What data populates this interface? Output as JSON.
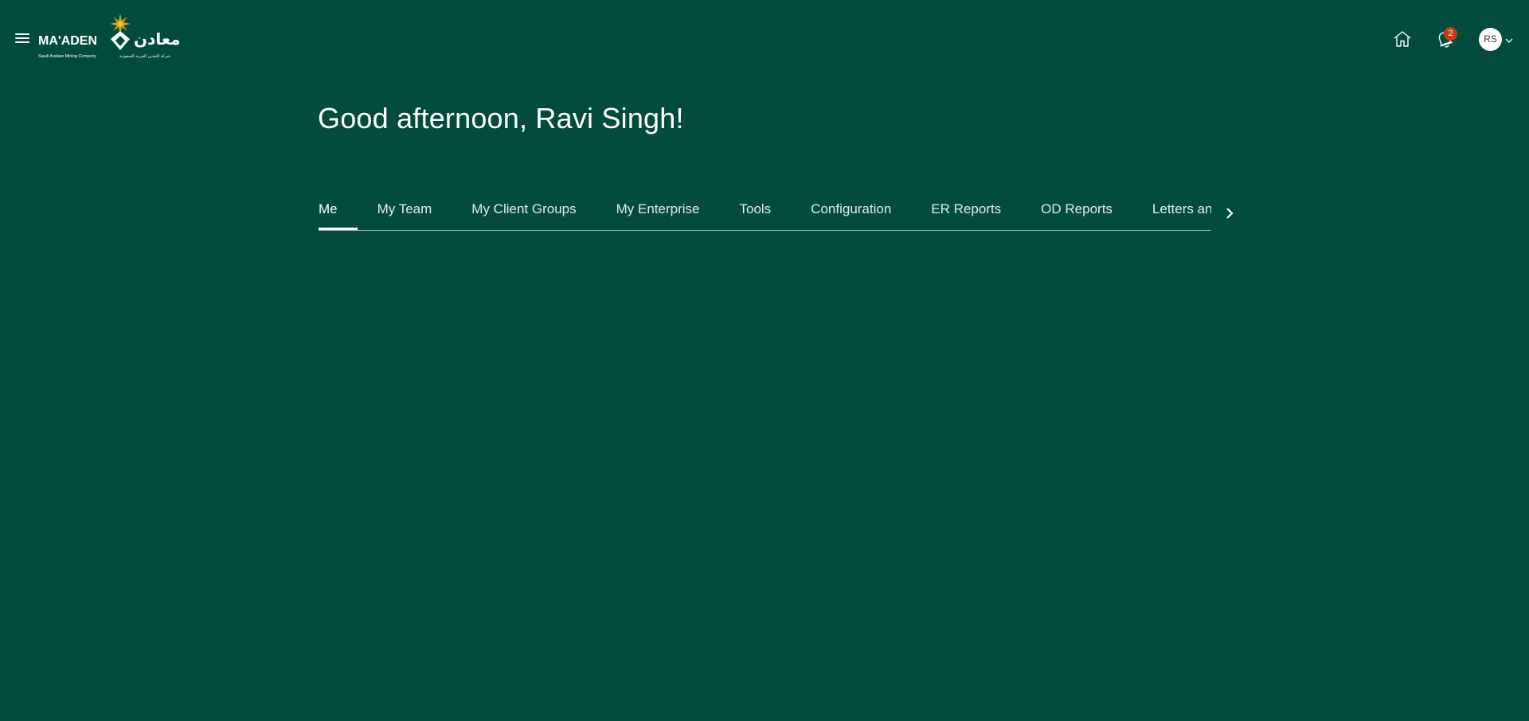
{
  "brand": {
    "name_latin": "MA'ADEN",
    "name_arabic": "معادن",
    "tagline_latin": "Saudi Arabian Mining Company",
    "tagline_arabic": "شركة التعدين العربية السعودية",
    "accent_color": "#d9a21c"
  },
  "header": {
    "menu_icon": "hamburger-icon",
    "home_icon": "home-icon",
    "notifications_icon": "bell-icon",
    "notification_count": "2",
    "avatar_initials": "RS",
    "avatar_menu_icon": "chevron-down-icon"
  },
  "greeting": "Good afternoon, Ravi Singh!",
  "tabs": [
    {
      "label": "Me",
      "active": true
    },
    {
      "label": "My Team",
      "active": false
    },
    {
      "label": "My Client Groups",
      "active": false
    },
    {
      "label": "My Enterprise",
      "active": false
    },
    {
      "label": "Tools",
      "active": false
    },
    {
      "label": "Configuration",
      "active": false
    },
    {
      "label": "ER Reports",
      "active": false
    },
    {
      "label": "OD Reports",
      "active": false
    },
    {
      "label": "Letters and",
      "active": false
    }
  ],
  "tabs_next_icon": "chevron-right-icon",
  "colors": {
    "background": "#034c3d",
    "badge": "#c63b12",
    "text": "#ffffff"
  }
}
